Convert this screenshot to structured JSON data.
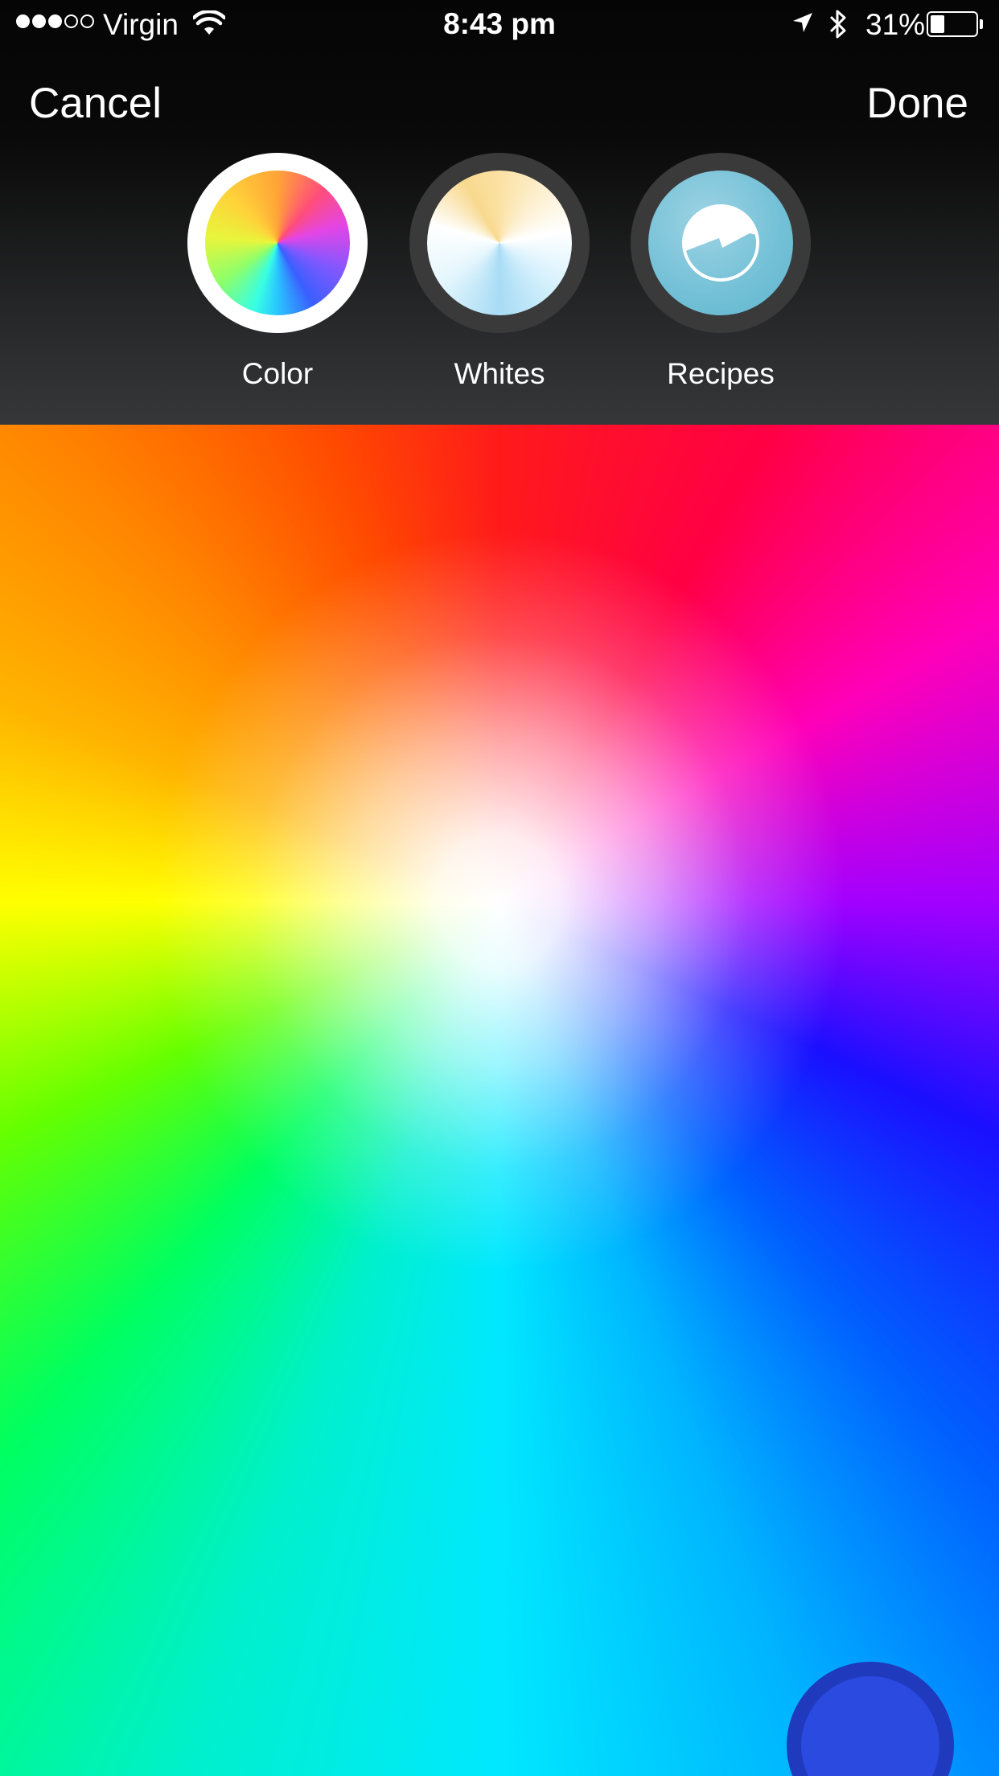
{
  "status_bar": {
    "signal": {
      "bars_filled": 3,
      "bars_total": 5
    },
    "carrier": "Virgin",
    "time": "8:43 pm",
    "battery_percent_label": "31%",
    "battery_level": 0.31,
    "icons": [
      "wifi-icon",
      "location-arrow-icon",
      "bluetooth-icon",
      "battery-icon"
    ]
  },
  "nav": {
    "cancel_label": "Cancel",
    "done_label": "Done"
  },
  "modes": [
    {
      "label": "Color",
      "selected": true,
      "icon": "color-wheel-icon"
    },
    {
      "label": "Whites",
      "selected": false,
      "icon": "whites-wheel-icon"
    },
    {
      "label": "Recipes",
      "selected": false,
      "icon": "recipes-icon"
    }
  ],
  "picker": {
    "selected_color": "#2a4ae0"
  }
}
